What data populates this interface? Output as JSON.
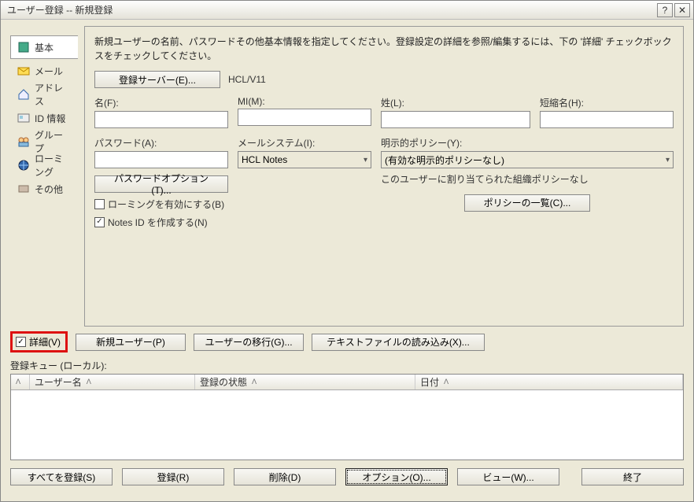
{
  "titlebar": {
    "title": "ユーザー登録 -- 新規登録"
  },
  "sidebar": {
    "items": [
      {
        "label": "基本"
      },
      {
        "label": "メール"
      },
      {
        "label": "アドレス"
      },
      {
        "label": "ID 情報"
      },
      {
        "label": "グループ"
      },
      {
        "label": "ローミング"
      },
      {
        "label": "その他"
      }
    ]
  },
  "intro": "新規ユーザーの名前、パスワードその他基本情報を指定してください。登録設定の詳細を参照/編集するには、下の '詳細' チェックボックスをチェックしてください。",
  "buttons": {
    "reg_server": "登録サーバー(E)...",
    "pwd_options": "パスワードオプション(T)...",
    "policy_list": "ポリシーの一覧(C)...",
    "new_user": "新規ユーザー(P)",
    "migrate": "ユーザーの移行(G)...",
    "text_import": "テキストファイルの読み込み(X)..."
  },
  "server_value": "HCL/V11",
  "fields": {
    "name_label": "名(F):",
    "mi_label": "MI(M):",
    "last_label": "姓(L):",
    "short_label": "短縮名(H):",
    "password_label": "パスワード(A):",
    "mailsys_label": "メールシステム(I):",
    "policy_label": "明示的ポリシー(Y):",
    "mailsys_value": "HCL Notes",
    "policy_value": "(有効な明示的ポリシーなし)"
  },
  "policy_info": "このユーザーに割り当てられた組織ポリシーなし",
  "checks": {
    "roaming": "ローミングを有効にする(B)",
    "notesid": "Notes ID を作成する(N)",
    "detail": "詳細(V)"
  },
  "queue": {
    "label": "登録キュー (ローカル):",
    "cols": {
      "user": "ユーザー名",
      "status": "登録の状態",
      "date": "日付"
    }
  },
  "bottom": {
    "register_all": "すべてを登録(S)",
    "register": "登録(R)",
    "delete": "削除(D)",
    "options": "オプション(O)...",
    "view": "ビュー(W)...",
    "close": "終了"
  }
}
